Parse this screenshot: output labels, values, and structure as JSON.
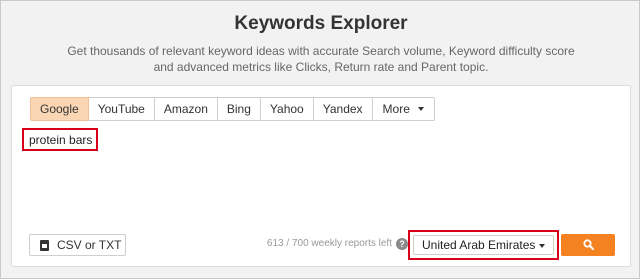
{
  "header": {
    "title": "Keywords Explorer",
    "subtitle": "Get thousands of relevant keyword ideas with accurate Search volume, Keyword difficulty score and advanced metrics like Clicks, Return rate and Parent topic."
  },
  "engines": {
    "tabs": [
      "Google",
      "YouTube",
      "Amazon",
      "Bing",
      "Yahoo",
      "Yandex"
    ],
    "active": "Google",
    "more_label": "More"
  },
  "keyword_input": {
    "value": "protein bars"
  },
  "footer": {
    "csv_label": "CSV or TXT",
    "reports_left": "613 / 700 weekly reports left",
    "help_glyph": "?",
    "country": "United Arab Emirates"
  },
  "colors": {
    "accent_orange": "#f58220",
    "active_tab": "#fbd6b4",
    "highlight_red": "#d9001b"
  },
  "icons": {
    "csv": "file-icon",
    "help": "question-icon",
    "search": "search-icon",
    "dropdown": "caret-down-icon"
  }
}
